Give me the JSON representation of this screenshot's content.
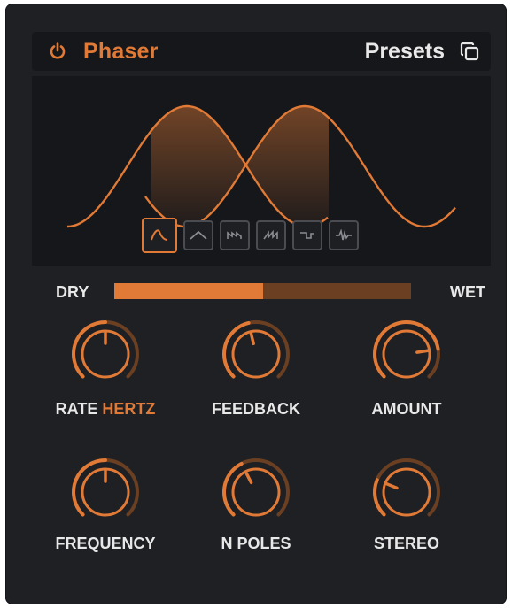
{
  "header": {
    "title": "Phaser",
    "presets_label": "Presets"
  },
  "wave_shapes": [
    {
      "name": "sine-wave-icon",
      "active": true
    },
    {
      "name": "triangle-wave-icon",
      "active": false
    },
    {
      "name": "saw-wave-icon",
      "active": false
    },
    {
      "name": "ramp-wave-icon",
      "active": false
    },
    {
      "name": "square-wave-icon",
      "active": false
    },
    {
      "name": "noise-wave-icon",
      "active": false
    }
  ],
  "mix": {
    "dry_label": "DRY",
    "wet_label": "WET",
    "fraction": 0.5
  },
  "knobs": [
    {
      "id": "rate",
      "label": "RATE",
      "unit": "HERTZ",
      "value": 0.5
    },
    {
      "id": "feedback",
      "label": "FEEDBACK",
      "unit": "",
      "value": 0.45
    },
    {
      "id": "amount",
      "label": "AMOUNT",
      "unit": "",
      "value": 0.8
    },
    {
      "id": "frequency",
      "label": "FREQUENCY",
      "unit": "",
      "value": 0.5
    },
    {
      "id": "n-poles",
      "label": "N POLES",
      "unit": "",
      "value": 0.4
    },
    {
      "id": "stereo",
      "label": "STEREO",
      "unit": "",
      "value": 0.25
    }
  ],
  "colors": {
    "accent": "#e07a36",
    "accent_dim": "#6a3f22",
    "panel": "#1e2024",
    "display": "#16171a",
    "text": "#e8e8e8"
  }
}
